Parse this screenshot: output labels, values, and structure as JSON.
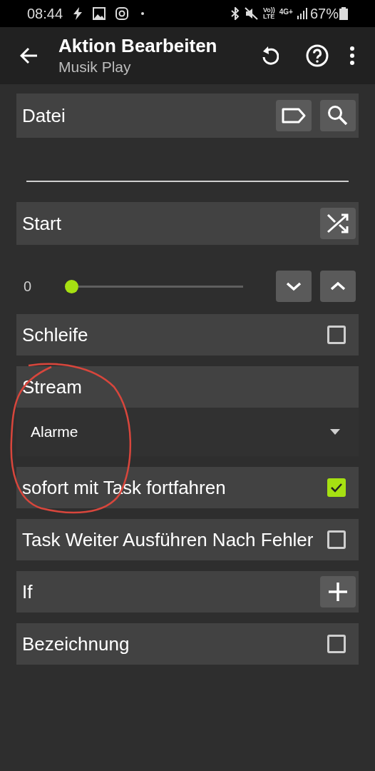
{
  "status_bar": {
    "time": "08:44",
    "battery": "67%",
    "network": "4G+",
    "volte_top": "Vo))",
    "volte_bottom": "LTE"
  },
  "app_bar": {
    "title": "Aktion Bearbeiten",
    "subtitle": "Musik Play"
  },
  "rows": [
    {
      "kind": "file",
      "label": "Datei"
    },
    {
      "kind": "text_field"
    },
    {
      "kind": "start",
      "label": "Start"
    },
    {
      "kind": "number_slider",
      "reading": "0",
      "level": 0
    },
    {
      "kind": "checkbox",
      "label": "Schleife",
      "checked": false
    },
    {
      "kind": "label",
      "label": "Stream"
    },
    {
      "kind": "dropdown",
      "value": "Alarme"
    },
    {
      "kind": "checkbox",
      "label": "sofort mit Task fortfahren",
      "checked": true
    },
    {
      "kind": "checkbox",
      "label": "Task Weiter Ausführen Nach Fehler",
      "checked": false
    },
    {
      "kind": "condition",
      "label": "If"
    },
    {
      "kind": "checkbox",
      "label": "Bezeichnung",
      "checked": false
    }
  ]
}
